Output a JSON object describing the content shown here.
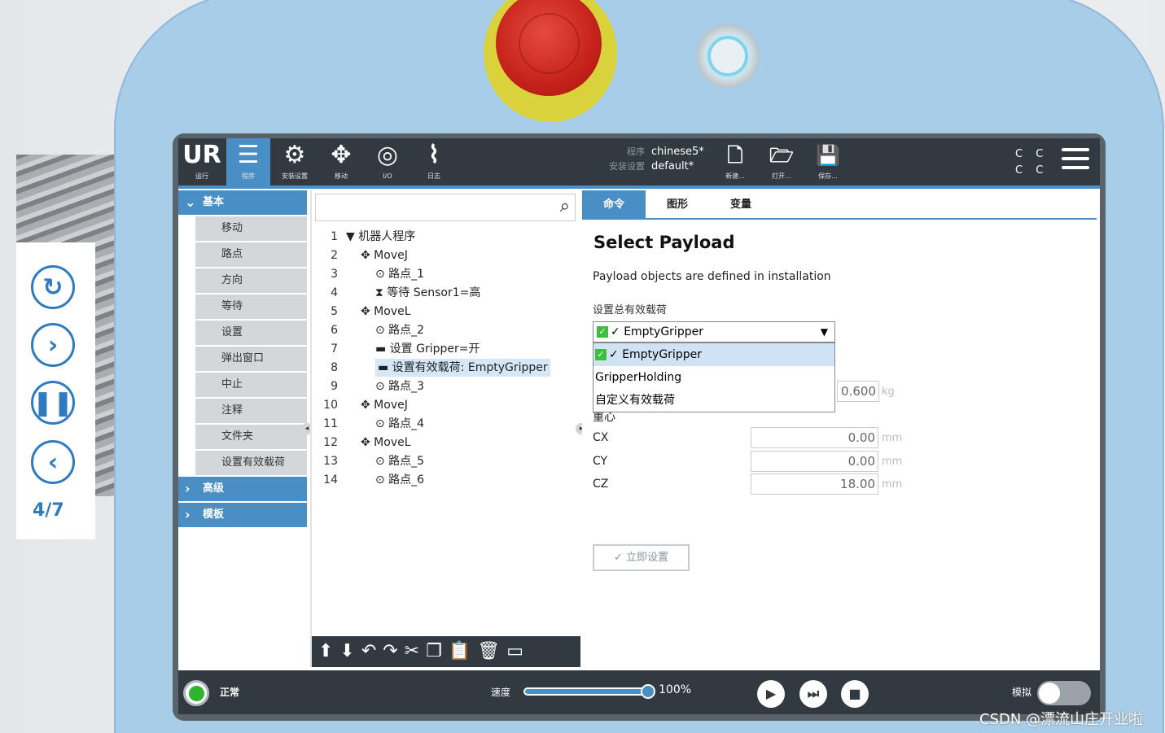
{
  "side": {
    "page_indicator": "4/7"
  },
  "topbar": {
    "buttons": [
      {
        "icon": "ur-logo-icon",
        "glyph": "UR",
        "label": "运行"
      },
      {
        "icon": "program-icon",
        "glyph": "☰",
        "label": "程序"
      },
      {
        "icon": "robot-arm-icon",
        "glyph": "⚙",
        "label": "安装设置"
      },
      {
        "icon": "move-icon",
        "glyph": "✥",
        "label": "移动"
      },
      {
        "icon": "io-icon",
        "glyph": "◎",
        "label": "I/O"
      },
      {
        "icon": "log-icon",
        "glyph": "⌇",
        "label": "日志"
      }
    ],
    "program_key": "程序",
    "program_value": "chinese5*",
    "install_key": "安装设置",
    "install_value": "default*",
    "file_buttons": [
      {
        "icon": "new-file-icon",
        "glyph": "🗋",
        "label": "新建..."
      },
      {
        "icon": "open-folder-icon",
        "glyph": "🗁",
        "label": "打开..."
      },
      {
        "icon": "save-icon",
        "glyph": "💾",
        "label": "保存..."
      }
    ],
    "cc": "C C\nC C"
  },
  "nav": {
    "basic_header": "基本",
    "basic_items": [
      "移动",
      "路点",
      "方向",
      "等待",
      "设置",
      "弹出窗口",
      "中止",
      "注释",
      "文件夹",
      "设置有效载荷"
    ],
    "advanced_header": "高级",
    "template_header": "模板"
  },
  "tree": {
    "search_placeholder": "",
    "rows": [
      {
        "n": "1",
        "text": "▼ 机器人程序",
        "indent": 0
      },
      {
        "n": "2",
        "text": "✥ MoveJ",
        "indent": 1
      },
      {
        "n": "3",
        "text": "⊙ 路点_1",
        "indent": 2
      },
      {
        "n": "4",
        "text": "⧗ 等待 Sensor1=高",
        "indent": 2
      },
      {
        "n": "5",
        "text": "✥ MoveL",
        "indent": 1
      },
      {
        "n": "6",
        "text": "⊙ 路点_2",
        "indent": 2
      },
      {
        "n": "7",
        "text": "▬ 设置 Gripper=开",
        "indent": 2
      },
      {
        "n": "8",
        "text": "▬ 设置有效载荷: EmptyGripper",
        "indent": 2,
        "selected": true
      },
      {
        "n": "9",
        "text": "⊙ 路点_3",
        "indent": 2
      },
      {
        "n": "10",
        "text": "✥ MoveJ",
        "indent": 1
      },
      {
        "n": "11",
        "text": "⊙ 路点_4",
        "indent": 2
      },
      {
        "n": "12",
        "text": "✥ MoveL",
        "indent": 1
      },
      {
        "n": "13",
        "text": "⊙ 路点_5",
        "indent": 2
      },
      {
        "n": "14",
        "text": "⊙ 路点_6",
        "indent": 2
      }
    ],
    "toolbar": "⬆⬇↶↷✂❐📋🗑▭"
  },
  "panel": {
    "tabs": [
      "命令",
      "图形",
      "变量"
    ],
    "title": "Select Payload",
    "description": "Payload objects are defined in installation",
    "set_total_label": "设置总有效载荷",
    "selected": "EmptyGripper",
    "options": [
      "EmptyGripper",
      "GripperHolding",
      "自定义有效载荷"
    ],
    "mass_value": "0.600",
    "mass_unit": "kg",
    "cog_label": "重心",
    "cx_label": "CX",
    "cx_value": "0.00",
    "cy_label": "CY",
    "cy_value": "0.00",
    "cz_label": "CZ",
    "cz_value": "18.00",
    "length_unit": "mm",
    "set_now_label": "立即设置"
  },
  "bottom": {
    "status": "正常",
    "speed_label": "速度",
    "speed_value": "100%",
    "sim_label": "模拟"
  },
  "watermark": "CSDN @漂流山庄开业啦"
}
